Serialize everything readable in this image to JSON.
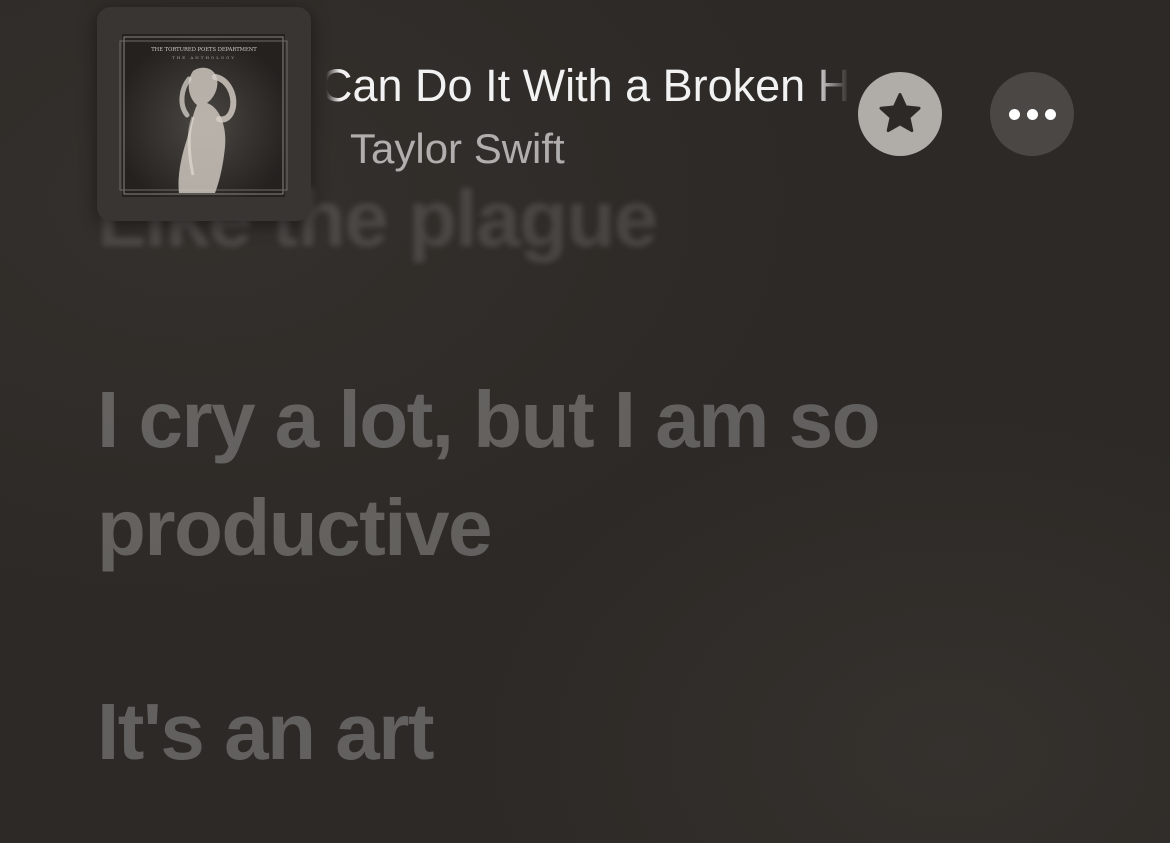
{
  "now_playing": {
    "title": "I Can Do It With a Broken Heart",
    "artist": "Taylor Swift",
    "artwork": {
      "title_line": "THE TORTURED POETS DEPARTMENT",
      "subtitle_line": "THE ANTHOLOGY"
    }
  },
  "controls": {
    "favorite_icon": "star-icon",
    "more_icon": "ellipsis-icon"
  },
  "lyrics": {
    "lines": [
      "Like the plague",
      "I cry a lot, but I am so",
      "productive",
      "It's an art"
    ]
  },
  "colors": {
    "background": "#2c2926",
    "favorite_button": "#b0aca8",
    "more_button": "#4a4744"
  }
}
